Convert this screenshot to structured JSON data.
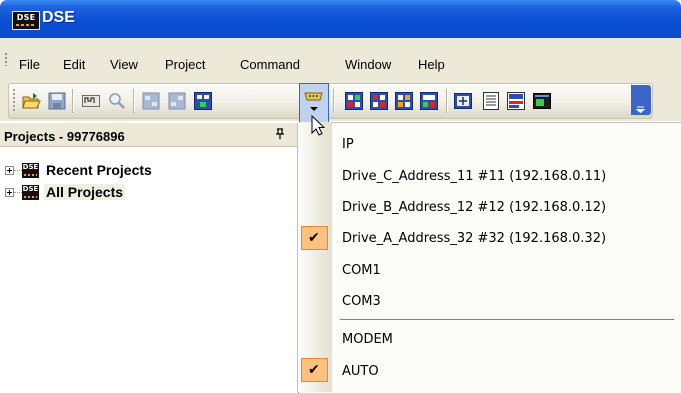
{
  "window": {
    "title": "DSE",
    "logo_text": "DSE",
    "title_gradient": "#0b4ccb"
  },
  "menubar": {
    "items": [
      "File",
      "Edit",
      "View",
      "Project",
      "Command",
      "Window",
      "Help"
    ]
  },
  "toolbar": {
    "buttons": [
      "open-project-icon",
      "save-icon",
      "connect-icon",
      "search-icon",
      "upload-icon",
      "download-icon",
      "network-icon",
      "serial-port-icon",
      "drive-red-icon",
      "drive-red-alt-icon",
      "drive-orange-icon",
      "drive-compare-icon",
      "add-node-icon",
      "parameter-list-icon",
      "graph-icon",
      "terminal-icon",
      "toolbar-options-icon"
    ]
  },
  "projects_panel": {
    "title": "Projects - 99776896",
    "pin_glyph": "ᵖ",
    "tree": [
      {
        "label": "Recent Projects",
        "icon_text": "DSE",
        "selected": false
      },
      {
        "label": "All Projects",
        "icon_text": "DSE",
        "selected": true
      }
    ]
  },
  "connection_menu": {
    "items": [
      {
        "label": "IP",
        "checked": false
      },
      {
        "label": "Drive_C_Address_11 #11 (192.168.0.11)",
        "checked": false
      },
      {
        "label": "Drive_B_Address_12 #12 (192.168.0.12)",
        "checked": false
      },
      {
        "label": "Drive_A_Address_32 #32 (192.168.0.32)",
        "checked": true
      },
      {
        "label": "COM1",
        "checked": false
      },
      {
        "label": "COM3",
        "checked": false
      },
      {
        "label": "MODEM",
        "checked": false
      },
      {
        "label": "AUTO",
        "checked": true
      }
    ],
    "check_glyph": "✔",
    "accent_color": "#ffc080"
  }
}
